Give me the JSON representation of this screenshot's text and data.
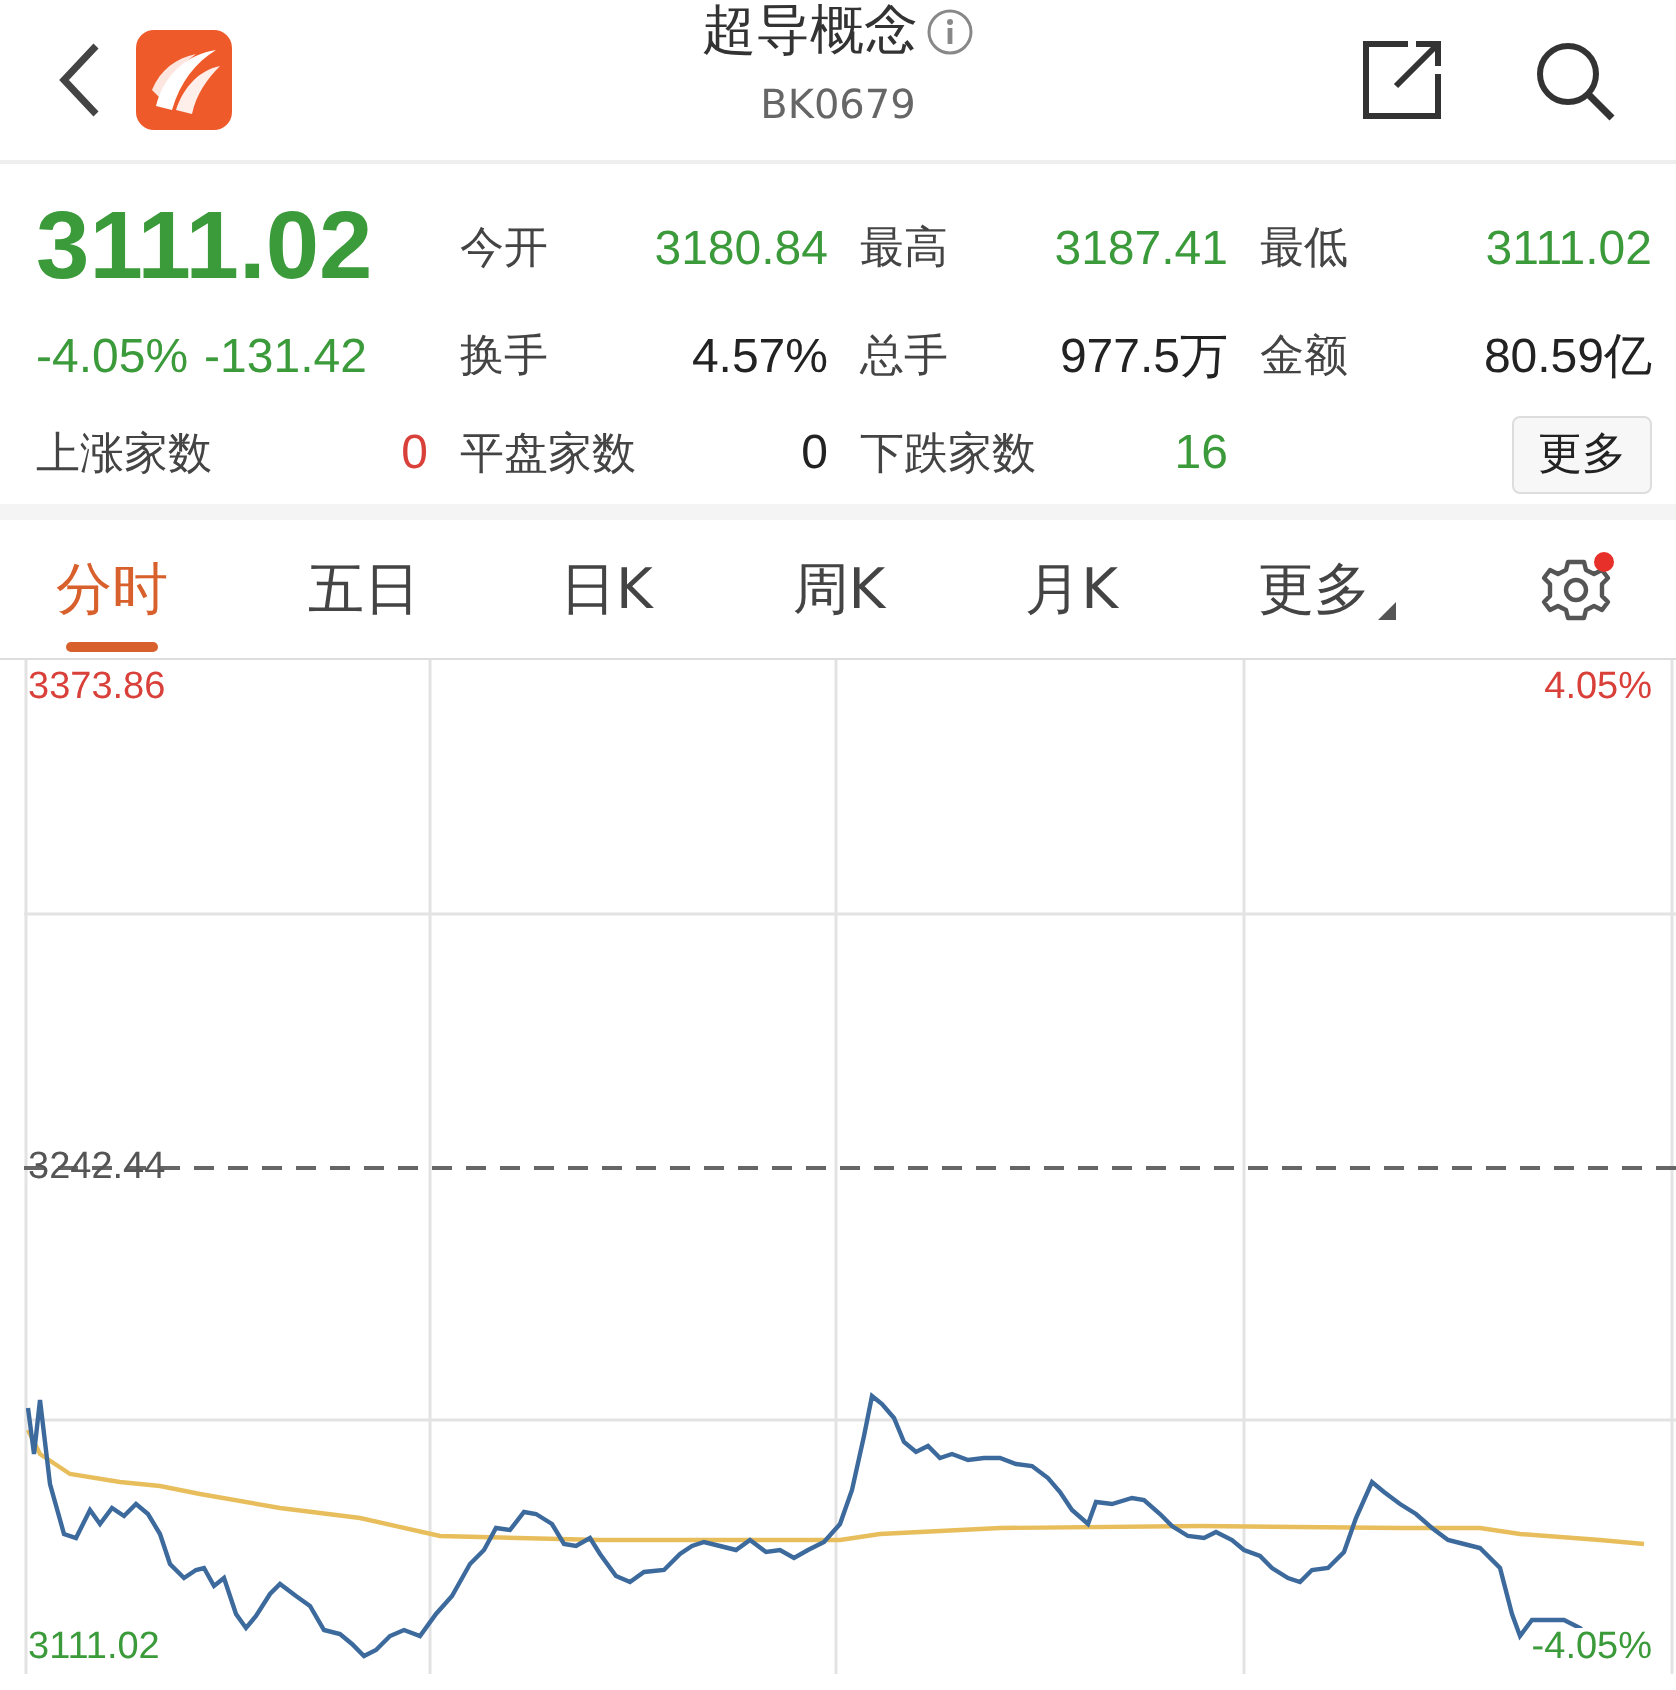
{
  "header": {
    "title": "超导概念",
    "code": "BK0679"
  },
  "quote": {
    "price": "3111.02",
    "change_pct": "-4.05%",
    "change": "-131.42",
    "color": "#3b9a3a"
  },
  "stats": [
    {
      "label": "今开",
      "value": "3180.84",
      "color": "#3b9a3a"
    },
    {
      "label": "最高",
      "value": "3187.41",
      "color": "#3b9a3a"
    },
    {
      "label": "最低",
      "value": "3111.02",
      "color": "#3b9a3a"
    },
    {
      "label": "换手",
      "value": "4.57%",
      "color": "#222222"
    },
    {
      "label": "总手",
      "value": "977.5万",
      "color": "#222222"
    },
    {
      "label": "金额",
      "value": "80.59亿",
      "color": "#222222"
    },
    {
      "label": "上涨家数",
      "value": "0",
      "color": "#d9403a"
    },
    {
      "label": "平盘家数",
      "value": "0",
      "color": "#222222"
    },
    {
      "label": "下跌家数",
      "value": "16",
      "color": "#3b9a3a"
    }
  ],
  "more_button": "更多",
  "tabs": [
    {
      "label": "分时",
      "selected": true,
      "kind": "tab"
    },
    {
      "label": "五日",
      "selected": false,
      "kind": "tab"
    },
    {
      "label": "日K",
      "selected": false,
      "kind": "tab"
    },
    {
      "label": "周K",
      "selected": false,
      "kind": "tab"
    },
    {
      "label": "月K",
      "selected": false,
      "kind": "tab"
    },
    {
      "label": "更多",
      "selected": false,
      "kind": "dropdown"
    }
  ],
  "settings": {
    "has_notification": true
  },
  "chart": {
    "axis_high_price": {
      "text": "3373.86",
      "color": "#d9403a"
    },
    "axis_high_percent": {
      "text": "4.05%",
      "color": "#d9403a"
    },
    "prev_close": {
      "text": "3242.44",
      "color": "#555555"
    },
    "axis_low_price": {
      "text": "3111.02",
      "color": "#3b9a3a"
    },
    "axis_low_percent": {
      "text": "-4.05%",
      "color": "#3b9a3a"
    }
  }
}
